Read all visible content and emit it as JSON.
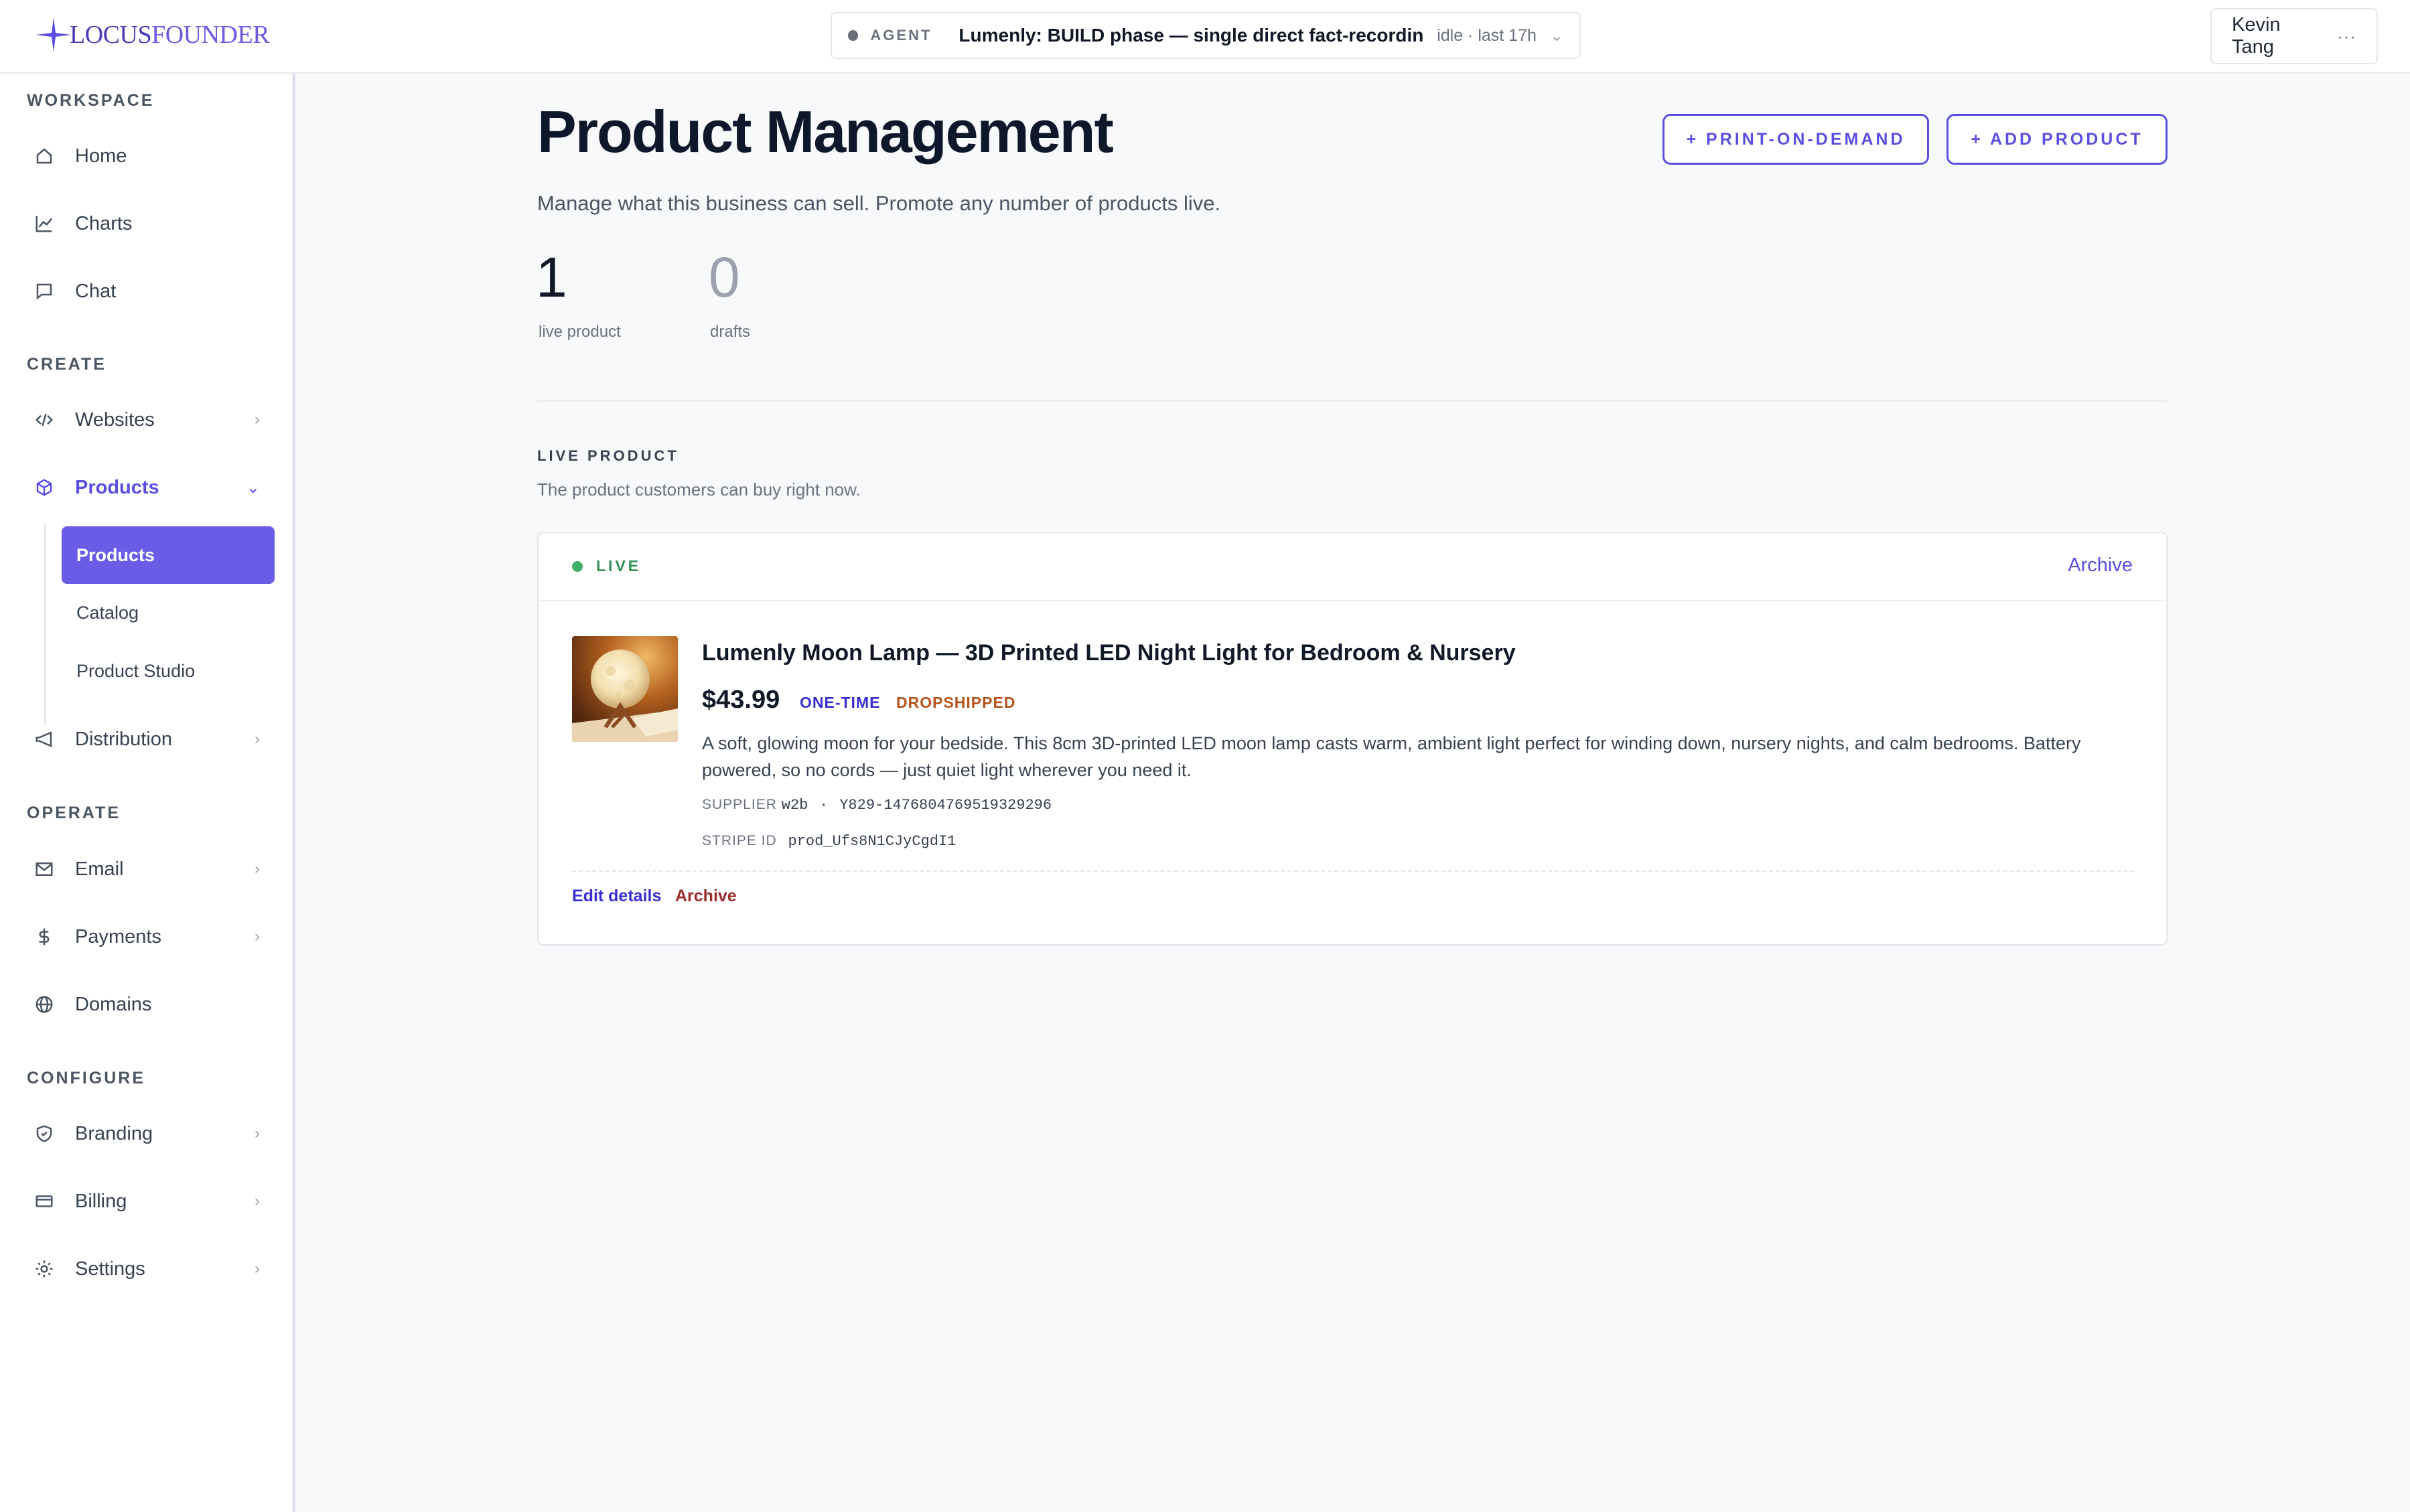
{
  "brand": {
    "logo_locus": "LOCUS",
    "logo_founder": "FOUNDER"
  },
  "agent": {
    "label": "AGENT",
    "task": "Lumenly: BUILD phase — single direct fact-recording ...",
    "status": "idle · last 17h"
  },
  "user": {
    "name": "Kevin Tang",
    "more": "···"
  },
  "sidebar": {
    "workspace_label": "WORKSPACE",
    "create_label": "CREATE",
    "operate_label": "OPERATE",
    "configure_label": "CONFIGURE",
    "items": {
      "home": "Home",
      "charts": "Charts",
      "chat": "Chat",
      "websites": "Websites",
      "products": "Products",
      "distribution": "Distribution",
      "email": "Email",
      "payments": "Payments",
      "domains": "Domains",
      "branding": "Branding",
      "billing": "Billing",
      "settings": "Settings"
    },
    "sub_items": {
      "products": "Products",
      "catalog": "Catalog",
      "studio": "Product Studio"
    },
    "chevron": "›",
    "chevron_open": "⌄"
  },
  "main": {
    "title": "Product Management",
    "subtitle": "Manage what this business can sell. Promote any number of products live.",
    "btn_print": "+ PRINT-ON-DEMAND",
    "btn_add": "+ ADD PRODUCT",
    "stats": {
      "live_count": "1",
      "live_label": "live product",
      "drafts_count": "0",
      "drafts_label": "drafts"
    },
    "live_section": {
      "heading": "LIVE PRODUCT",
      "description": "The product customers can buy right now."
    }
  },
  "product": {
    "status": "LIVE",
    "archive_top": "Archive",
    "name": "Lumenly Moon Lamp — 3D Printed LED Night Light for Bedroom & Nursery",
    "price": "$43.99",
    "tag_billing": "ONE-TIME",
    "tag_fulfillment": "DROPSHIPPED",
    "description": "A soft, glowing moon for your bedside. This 8cm 3D-printed LED moon lamp casts warm, ambient light perfect for winding down, nursery nights, and calm bedrooms. Battery powered, so no cords — just quiet light wherever you need it.",
    "supplier_label": "SUPPLIER",
    "supplier_name": "w2b",
    "supplier_sep": "·",
    "supplier_sku": "Y829-1476804769519329296",
    "stripe_label": "STRIPE ID",
    "stripe_id": "prod_Ufs8N1CJyCgdI1",
    "edit_link": "Edit details",
    "archive_link": "Archive"
  },
  "colors": {
    "accent": "#5b4ee0",
    "live_green": "#3fae6a",
    "dropship_orange": "#b4531a",
    "archive_red": "#9b2c2c"
  }
}
